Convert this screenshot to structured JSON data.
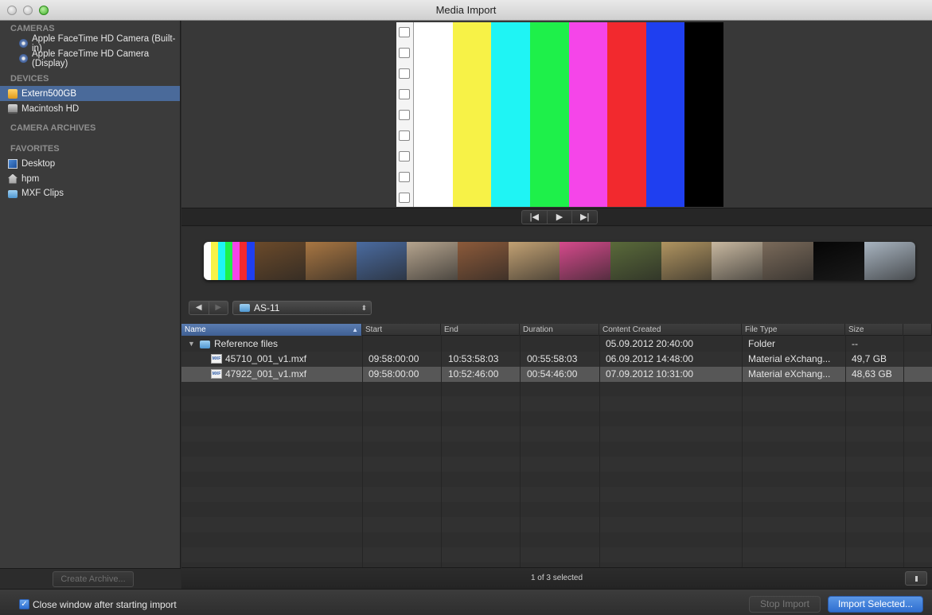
{
  "window": {
    "title": "Media Import"
  },
  "sidebar": {
    "sections": [
      {
        "label": "CAMERAS"
      },
      {
        "label": "DEVICES"
      },
      {
        "label": "CAMERA ARCHIVES"
      },
      {
        "label": "FAVORITES"
      }
    ],
    "cameras": [
      {
        "label": "Apple FaceTime HD Camera (Built-in)",
        "icon": "camera-icon"
      },
      {
        "label": "Apple FaceTime HD Camera (Display)",
        "icon": "camera-icon"
      }
    ],
    "devices": [
      {
        "label": "Extern500GB",
        "icon": "external-drive-icon",
        "selected": true
      },
      {
        "label": "Macintosh HD",
        "icon": "hard-drive-icon"
      }
    ],
    "favorites": [
      {
        "label": "Desktop",
        "icon": "desktop-icon"
      },
      {
        "label": "hpm",
        "icon": "home-icon"
      },
      {
        "label": "MXF Clips",
        "icon": "folder-icon"
      }
    ],
    "create_archive_label": "Create Archive..."
  },
  "viewer": {
    "color_bars": [
      "#ffffff",
      "#f7f247",
      "#1ff4f4",
      "#1ef04a",
      "#f545e9",
      "#f2292e",
      "#1f3ff0",
      "#000000"
    ],
    "transport": {
      "prev": "|◀",
      "play": "▶",
      "next": "▶|"
    }
  },
  "filmstrip": {
    "thumb_colors": [
      "#d9c8b0",
      "#6b4a2a",
      "#a87642",
      "#4a6ba0",
      "#b5a48e",
      "#8c5a3a",
      "#c2a173",
      "#d64a8c",
      "#5a6a3a",
      "#b09460",
      "#c8b8a0",
      "#7a6a5a",
      "#050505",
      "#a8b4c0"
    ]
  },
  "pathbar": {
    "back": "◀",
    "forward": "▶",
    "current_folder": "AS-11",
    "popup_arrows": "⬍"
  },
  "table": {
    "columns": [
      "Name",
      "Start",
      "End",
      "Duration",
      "Content Created",
      "File Type",
      "Size"
    ],
    "sorted_column": "Name",
    "rows": [
      {
        "name": "Reference files",
        "start": "",
        "end": "",
        "duration": "",
        "created": "05.09.2012 20:40:00",
        "type": "Folder",
        "size": "--",
        "kind": "folder"
      },
      {
        "name": "45710_001_v1.mxf",
        "start": "09:58:00:00",
        "end": "10:53:58:03",
        "duration": "00:55:58:03",
        "created": "06.09.2012 14:48:00",
        "type": "Material eXchang...",
        "size": "49,7 GB",
        "kind": "mxf"
      },
      {
        "name": "47922_001_v1.mxf",
        "start": "09:58:00:00",
        "end": "10:52:46:00",
        "duration": "00:54:46:00",
        "created": "07.09.2012 10:31:00",
        "type": "Material eXchang...",
        "size": "48,63 GB",
        "kind": "mxf",
        "selected": true
      }
    ],
    "mxf_badge": "MXF"
  },
  "status": {
    "selection_text": "1 of 3 selected"
  },
  "footer": {
    "close_window_label": "Close window after starting import",
    "close_window_checked": true,
    "stop_import_label": "Stop Import",
    "import_selected_label": "Import Selected..."
  }
}
